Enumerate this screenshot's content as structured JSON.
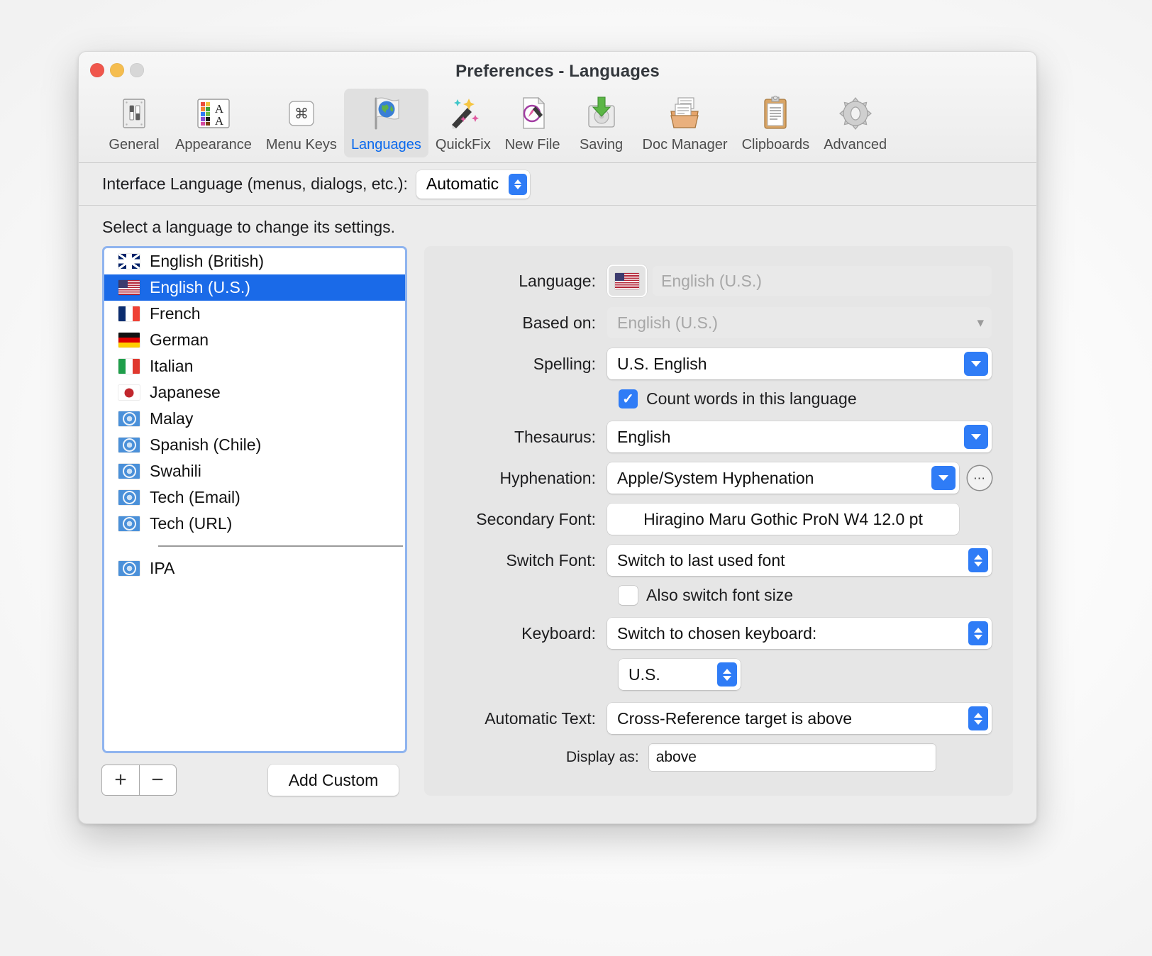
{
  "window": {
    "title": "Preferences - Languages",
    "traffic": [
      "close",
      "minimize",
      "zoom"
    ]
  },
  "toolbar": {
    "items": [
      {
        "label": "General",
        "icon": "switches-icon",
        "selected": false
      },
      {
        "label": "Appearance",
        "icon": "color-font-icon",
        "selected": false
      },
      {
        "label": "Menu Keys",
        "icon": "command-key-icon",
        "selected": false
      },
      {
        "label": "Languages",
        "icon": "globe-flag-icon",
        "selected": true
      },
      {
        "label": "QuickFix",
        "icon": "magic-wand-icon",
        "selected": false
      },
      {
        "label": "New File",
        "icon": "new-document-icon",
        "selected": false
      },
      {
        "label": "Saving",
        "icon": "save-drive-icon",
        "selected": false
      },
      {
        "label": "Doc Manager",
        "icon": "doc-tray-icon",
        "selected": false
      },
      {
        "label": "Clipboards",
        "icon": "clipboard-icon",
        "selected": false
      },
      {
        "label": "Advanced",
        "icon": "gear-icon",
        "selected": false
      }
    ]
  },
  "interface": {
    "label": "Interface Language (menus, dialogs, etc.):",
    "value": "Automatic"
  },
  "hint": "Select a language to change its settings.",
  "language_list": {
    "items": [
      {
        "label": "English (British)",
        "flag": "uk",
        "selected": false
      },
      {
        "label": "English (U.S.)",
        "flag": "us",
        "selected": true
      },
      {
        "label": "French",
        "flag": "fr",
        "selected": false
      },
      {
        "label": "German",
        "flag": "de",
        "selected": false
      },
      {
        "label": "Italian",
        "flag": "it",
        "selected": false
      },
      {
        "label": "Japanese",
        "flag": "jp",
        "selected": false
      },
      {
        "label": "Malay",
        "flag": "un",
        "selected": false
      },
      {
        "label": "Spanish (Chile)",
        "flag": "un",
        "selected": false
      },
      {
        "label": "Swahili",
        "flag": "un",
        "selected": false
      },
      {
        "label": "Tech (Email)",
        "flag": "un",
        "selected": false
      },
      {
        "label": "Tech (URL)",
        "flag": "un",
        "selected": false
      },
      {
        "label": "IPA",
        "flag": "un",
        "selected": false
      }
    ],
    "separator_after_index": 10,
    "add_button": "+",
    "remove_button": "−",
    "add_custom_button": "Add Custom"
  },
  "details": {
    "language": {
      "label": "Language:",
      "value": "English (U.S.)",
      "flag": "us",
      "disabled": true
    },
    "based_on": {
      "label": "Based on:",
      "value": "English (U.S.)",
      "disabled": true
    },
    "spelling": {
      "label": "Spelling:",
      "value": "U.S. English"
    },
    "count_words": {
      "label": "Count words in this language",
      "checked": true
    },
    "thesaurus": {
      "label": "Thesaurus:",
      "value": "English"
    },
    "hyphenation": {
      "label": "Hyphenation:",
      "value": "Apple/System Hyphenation",
      "more_button": "⋯"
    },
    "secondary_font": {
      "label": "Secondary Font:",
      "value": "Hiragino Maru Gothic ProN W4 12.0 pt"
    },
    "switch_font": {
      "label": "Switch Font:",
      "value": "Switch to last used font"
    },
    "also_switch_size": {
      "label": "Also switch font size",
      "checked": false
    },
    "keyboard": {
      "label": "Keyboard:",
      "value": "Switch to chosen keyboard:",
      "sub_value": "U.S."
    },
    "automatic_text": {
      "label": "Automatic Text:",
      "value": "Cross-Reference target is above"
    },
    "display_as": {
      "label": "Display as:",
      "value": "above"
    }
  },
  "colors": {
    "accent": "#2f7cf6",
    "selection": "#1a6ae8",
    "focus_ring": "#8fb4ef",
    "window_bg": "#ececec",
    "panel_bg": "#e6e6e6"
  }
}
